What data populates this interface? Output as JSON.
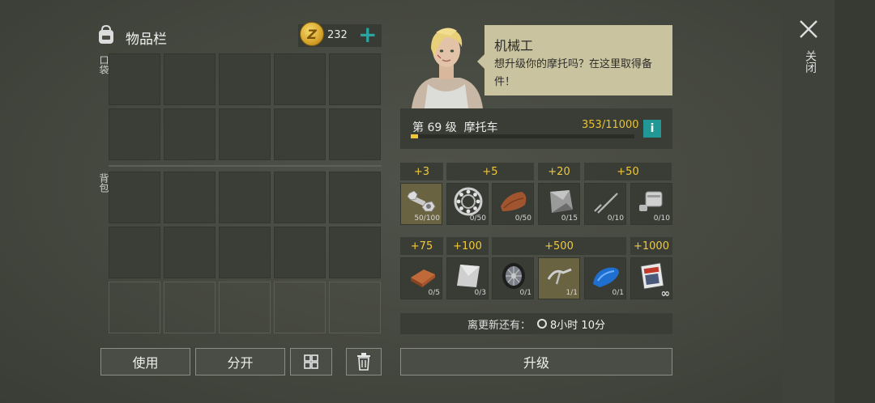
{
  "inventory": {
    "title": "物品栏",
    "pocket_label": "口袋",
    "backpack_label": "背包",
    "coins": "232"
  },
  "buttons": {
    "use": "使用",
    "split": "分开",
    "upgrade": "升级"
  },
  "mechanic": {
    "name": "机械工",
    "message": "想升级你的摩托吗？在这里取得备件！"
  },
  "level": {
    "label": "第 69 级",
    "vehicle": "摩托车",
    "progress": "353/11000",
    "progress_fraction": 0.032
  },
  "tiers_row1": [
    "+3",
    "+5",
    "+20",
    "+50"
  ],
  "tiers_row2": [
    "+75",
    "+100",
    "+500",
    "+1000"
  ],
  "parts_row1": [
    {
      "icon": "bolt-nut-icon",
      "qty": "50/100"
    },
    {
      "icon": "bearing-icon",
      "qty": "0/50"
    },
    {
      "icon": "leather-icon",
      "qty": "0/50"
    },
    {
      "icon": "metal-plate-icon",
      "qty": "0/15"
    },
    {
      "icon": "spring-icon",
      "qty": "0/10"
    },
    {
      "icon": "piston-icon",
      "qty": "0/10"
    }
  ],
  "parts_row2": [
    {
      "icon": "copper-ingot-icon",
      "qty": "0/5"
    },
    {
      "icon": "steel-sheet-icon",
      "qty": "0/3"
    },
    {
      "icon": "wheel-icon",
      "qty": "0/1"
    },
    {
      "icon": "handlebar-icon",
      "qty": "1/1"
    },
    {
      "icon": "fuel-tank-icon",
      "qty": "0/1"
    },
    {
      "icon": "magazine-icon",
      "qty": "∞"
    }
  ],
  "timer": {
    "label": "离更新还有：",
    "value": "8小时 10分"
  },
  "close_label": "关闭",
  "colors": {
    "accent_teal": "#219895",
    "gold": "#f0c93a",
    "bubble": "#c9c3a0"
  }
}
